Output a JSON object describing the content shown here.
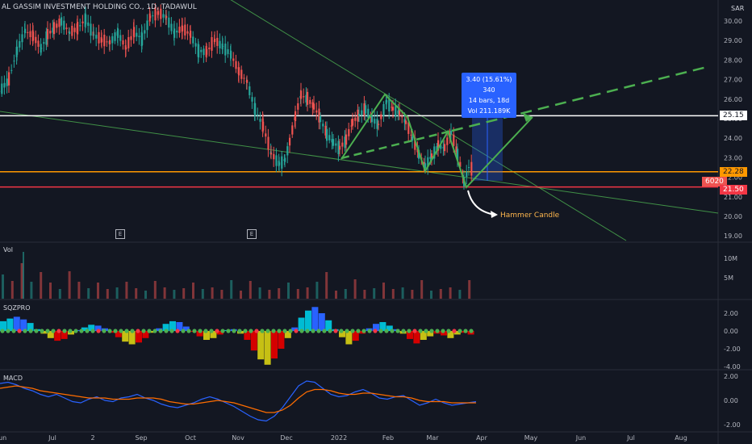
{
  "header": {
    "symbol": "AL GASSIM INVESTMENT HOLDING CO., 1D, TADAWUL"
  },
  "price_axis": {
    "currency": "SAR",
    "ticks": [
      "30.00",
      "29.00",
      "28.00",
      "27.00",
      "26.00",
      "25.00",
      "24.00",
      "23.00",
      "22.00",
      "21.00",
      "20.00",
      "19.00"
    ],
    "tag_resistance": "25.15",
    "tag_support": "22.28",
    "tag_volume_overlay": "6020",
    "tag_low": "21.50"
  },
  "colors": {
    "resistance": "#ffffff",
    "support": "#ff9800",
    "low": "#f23645",
    "pattern": "#4caf50",
    "measure": "#2962ff",
    "up": "#26a69a",
    "down": "#ef5350"
  },
  "measure_box": {
    "line1": "3.40 (15.61%) 340",
    "line2": "14 bars, 18d",
    "line3": "Vol 211.189K"
  },
  "annotation": {
    "text": "Hammer Candle"
  },
  "earnings": {
    "e1": "E",
    "e2": "E"
  },
  "panes": {
    "volume": {
      "title": "Vol",
      "ticks": [
        "10M",
        "5M"
      ]
    },
    "sqzmom": {
      "title": "SQZPRO",
      "ticks": [
        "2.00",
        "0.00",
        "-2.00",
        "-4.00"
      ]
    },
    "macd": {
      "title": "MACD",
      "ticks": [
        "2.00",
        "0.00",
        "-2.00"
      ]
    }
  },
  "time_axis": [
    "Jun",
    "Jul",
    "2",
    "Sep",
    "Oct",
    "Nov",
    "Dec",
    "2022",
    "Feb",
    "Mar",
    "Apr",
    "May",
    "Jun",
    "Jul",
    "Aug"
  ],
  "chart_data": {
    "type": "candlestick",
    "ylim": [
      18.8,
      30.6
    ],
    "levels": {
      "resistance": 25.15,
      "support": 22.28,
      "low": 21.5
    },
    "price_path": [
      [
        -2,
        26.4
      ],
      [
        10,
        27.0
      ],
      [
        20,
        28.5
      ],
      [
        30,
        29.5
      ],
      [
        40,
        29.2
      ],
      [
        50,
        28.6
      ],
      [
        58,
        29.3
      ],
      [
        66,
        29.6
      ],
      [
        75,
        30.0
      ],
      [
        85,
        29.4
      ],
      [
        95,
        29.6
      ],
      [
        105,
        30.1
      ],
      [
        115,
        29.3
      ],
      [
        125,
        29.0
      ],
      [
        135,
        28.9
      ],
      [
        145,
        29.4
      ],
      [
        155,
        28.6
      ],
      [
        165,
        29.4
      ],
      [
        175,
        29.1
      ],
      [
        185,
        30.2
      ],
      [
        195,
        30.4
      ],
      [
        205,
        30.2
      ],
      [
        215,
        29.4
      ],
      [
        225,
        29.6
      ],
      [
        235,
        29.3
      ],
      [
        245,
        28.5
      ],
      [
        255,
        28.4
      ],
      [
        265,
        29.0
      ],
      [
        275,
        28.7
      ],
      [
        285,
        28.3
      ],
      [
        295,
        27.4
      ],
      [
        305,
        26.9
      ],
      [
        315,
        25.5
      ],
      [
        325,
        24.6
      ],
      [
        335,
        23.2
      ],
      [
        345,
        22.7
      ],
      [
        352,
        22.9
      ],
      [
        358,
        23.8
      ],
      [
        365,
        25.1
      ],
      [
        372,
        26.2
      ],
      [
        380,
        26.0
      ],
      [
        388,
        25.6
      ],
      [
        396,
        25.0
      ],
      [
        404,
        24.2
      ],
      [
        412,
        23.8
      ],
      [
        420,
        23.5
      ],
      [
        428,
        23.9
      ],
      [
        436,
        24.8
      ],
      [
        444,
        25.2
      ],
      [
        452,
        25.5
      ],
      [
        460,
        25.0
      ],
      [
        468,
        24.7
      ],
      [
        478,
        25.9
      ],
      [
        486,
        25.5
      ],
      [
        494,
        25.3
      ],
      [
        502,
        24.8
      ],
      [
        510,
        24.0
      ],
      [
        518,
        23.2
      ],
      [
        526,
        22.6
      ],
      [
        534,
        23.1
      ],
      [
        542,
        23.6
      ],
      [
        550,
        23.5
      ],
      [
        558,
        24.3
      ],
      [
        566,
        23.2
      ],
      [
        574,
        21.8
      ],
      [
        580,
        22.5
      ],
      [
        586,
        22.3
      ]
    ],
    "volume_bars": [
      3,
      2,
      4,
      2,
      3,
      2,
      1,
      3,
      2,
      1,
      2,
      1,
      1,
      2,
      1,
      1,
      2,
      1,
      1,
      1,
      2,
      1,
      1,
      1,
      2,
      1,
      2,
      1,
      1,
      1,
      2,
      1,
      1,
      2,
      3,
      1,
      1,
      2,
      1,
      1,
      2,
      1,
      1,
      1,
      2,
      1,
      1,
      1,
      1,
      2
    ],
    "sqz_hist": [
      1.1,
      1.4,
      1.6,
      1.3,
      0.9,
      0.2,
      -0.3,
      -0.8,
      -1.1,
      -0.9,
      -0.4,
      0.1,
      0.4,
      0.7,
      0.6,
      0.3,
      -0.2,
      -0.7,
      -1.2,
      -1.5,
      -1.3,
      -0.8,
      -0.2,
      0.3,
      0.8,
      1.1,
      1.0,
      0.5,
      -0.1,
      -0.6,
      -1.0,
      -0.8,
      -0.4,
      0.1,
      0.2,
      -0.3,
      -1.0,
      -2.2,
      -3.2,
      -3.8,
      -3.1,
      -2.0,
      -0.8,
      0.4,
      1.5,
      2.3,
      2.7,
      2.0,
      1.2,
      0.2,
      -0.7,
      -1.5,
      -1.1,
      -0.3,
      0.3,
      0.8,
      1.0,
      0.6,
      0.2,
      -0.3,
      -0.9,
      -1.4,
      -1.0,
      -0.6,
      -0.3,
      -0.5,
      -0.8,
      -0.4,
      -0.2,
      -0.4
    ],
    "macd": {
      "macd": [
        1.4,
        1.5,
        1.3,
        1.0,
        0.8,
        0.5,
        0.3,
        0.5,
        0.2,
        -0.1,
        -0.2,
        0.1,
        0.3,
        0.0,
        -0.1,
        0.2,
        0.3,
        0.5,
        0.2,
        0.0,
        -0.3,
        -0.5,
        -0.6,
        -0.4,
        -0.2,
        0.1,
        0.3,
        0.1,
        -0.2,
        -0.5,
        -0.9,
        -1.3,
        -1.6,
        -1.7,
        -1.3,
        -0.6,
        0.3,
        1.2,
        1.6,
        1.5,
        1.0,
        0.5,
        0.3,
        0.4,
        0.7,
        0.9,
        0.6,
        0.2,
        0.1,
        0.3,
        0.4,
        0.0,
        -0.4,
        -0.2,
        0.1,
        -0.2,
        -0.4,
        -0.3,
        -0.2,
        -0.1
      ],
      "signal": [
        1.0,
        1.1,
        1.2,
        1.1,
        1.0,
        0.8,
        0.7,
        0.6,
        0.5,
        0.4,
        0.3,
        0.2,
        0.2,
        0.2,
        0.1,
        0.1,
        0.1,
        0.2,
        0.2,
        0.2,
        0.1,
        -0.1,
        -0.2,
        -0.3,
        -0.3,
        -0.2,
        -0.1,
        0.0,
        -0.1,
        -0.2,
        -0.4,
        -0.6,
        -0.8,
        -1.0,
        -1.0,
        -0.8,
        -0.4,
        0.2,
        0.7,
        0.9,
        0.9,
        0.8,
        0.6,
        0.5,
        0.5,
        0.6,
        0.6,
        0.5,
        0.4,
        0.3,
        0.3,
        0.2,
        0.0,
        -0.1,
        -0.1,
        -0.1,
        -0.2,
        -0.2,
        -0.2,
        -0.2
      ]
    }
  }
}
